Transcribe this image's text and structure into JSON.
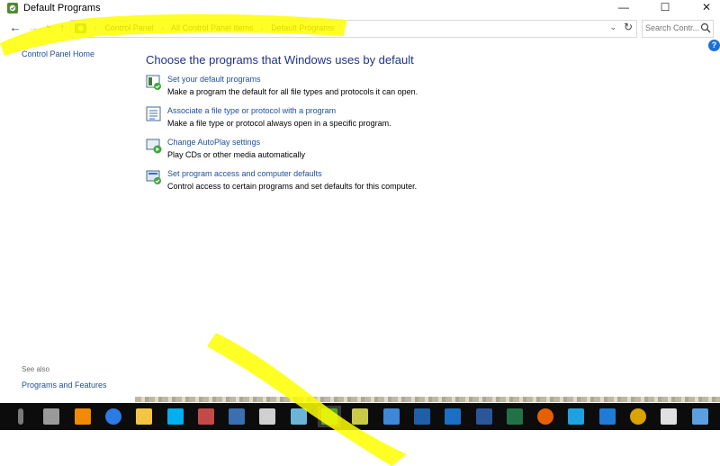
{
  "window": {
    "title": "Default Programs",
    "minimize_glyph": "—",
    "maximize_glyph": "☐",
    "close_glyph": "✕"
  },
  "nav": {
    "back": "←",
    "forward": "→",
    "recent": "⌄",
    "up": "↑"
  },
  "breadcrumb": [
    "Control Panel",
    "All Control Panel Items",
    "Default Programs"
  ],
  "address": {
    "dropdown_glyph": "⌄",
    "refresh_glyph": "↻"
  },
  "search": {
    "placeholder": "Search Contr..."
  },
  "help": {
    "glyph": "?"
  },
  "sidebar": {
    "home_link": "Control Panel Home",
    "see_also_label": "See also",
    "see_also_links": [
      "Programs and Features"
    ]
  },
  "main": {
    "heading": "Choose the programs that Windows uses by default",
    "tasks": [
      {
        "link": "Set your default programs",
        "description": "Make a program the default for all file types and protocols it can open.",
        "icon": "default-programs-icon"
      },
      {
        "link": "Associate a file type or protocol with a program",
        "description": "Make a file type or protocol always open in a specific program.",
        "icon": "file-association-icon"
      },
      {
        "link": "Change AutoPlay settings",
        "description": "Play CDs or other media automatically",
        "icon": "autoplay-icon"
      },
      {
        "link": "Set program access and computer defaults",
        "description": "Control access to certain programs and set defaults for this computer.",
        "icon": "program-access-icon"
      }
    ]
  },
  "colors": {
    "link": "#1f4e9b",
    "heading": "#1e3287",
    "highlight": "#ffff00",
    "taskbar": "#0c0c0c"
  },
  "taskbar": {
    "icons": [
      {
        "name": "microphone-icon",
        "color": "#7a7a7a"
      },
      {
        "name": "task-view-icon",
        "color": "#9a9a9a"
      },
      {
        "name": "vlc-icon",
        "color": "#f08a00"
      },
      {
        "name": "cortana-icon",
        "color": "#2a7be4"
      },
      {
        "name": "file-explorer-icon",
        "color": "#f4c542"
      },
      {
        "name": "skype-icon",
        "color": "#00aff0"
      },
      {
        "name": "network-icon",
        "color": "#c44a4a"
      },
      {
        "name": "monitor-icon",
        "color": "#3a6fb0"
      },
      {
        "name": "calculator-icon",
        "color": "#d0d0d0"
      },
      {
        "name": "notepad-icon",
        "color": "#6bb5d8"
      },
      {
        "name": "game-icon",
        "color": "#55a630"
      },
      {
        "name": "default-programs-taskbar-icon",
        "color": "#c9c94a"
      },
      {
        "name": "remote-desktop-icon",
        "color": "#3e88d8"
      },
      {
        "name": "powershell-icon",
        "color": "#1f5fa8"
      },
      {
        "name": "outlook-icon",
        "color": "#1b6fc4"
      },
      {
        "name": "word-icon",
        "color": "#2b579a"
      },
      {
        "name": "excel-icon",
        "color": "#217346"
      },
      {
        "name": "firefox-icon",
        "color": "#e66000"
      },
      {
        "name": "internet-explorer-icon",
        "color": "#1ea1e0"
      },
      {
        "name": "edge-icon",
        "color": "#1f7cd6"
      },
      {
        "name": "chrome-icon",
        "color": "#d9a300"
      },
      {
        "name": "photos-icon",
        "color": "#e0e0e0"
      },
      {
        "name": "media-icon",
        "color": "#5aa0e0"
      }
    ]
  }
}
